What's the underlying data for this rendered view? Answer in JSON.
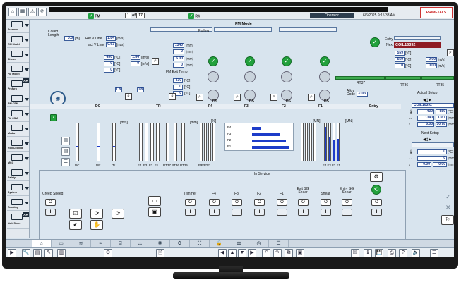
{
  "topbar": {
    "fm_label": "FM",
    "page_current": "1",
    "page_of": "of",
    "page_total": "17",
    "rm_label": "RM",
    "operator": "Operator",
    "datetime": "6/6/2025 9:15:33 AM",
    "logo": "PRIMETALS"
  },
  "sidebar": {
    "items": [
      {
        "label": "Furnace"
      },
      {
        "label": "RM Model"
      },
      {
        "label": "Shears"
      },
      {
        "label": "FM Model"
      },
      {
        "label": "Prkfurn"
      },
      {
        "label": "RM CSM"
      },
      {
        "label": "FM CSM"
      },
      {
        "label": "Media"
      },
      {
        "label": "Roll Cooling"
      },
      {
        "label": "MCC"
      },
      {
        "label": "Safety"
      },
      {
        "label": "System"
      },
      {
        "label": "Tracking"
      },
      {
        "label": "Volt. Sheet"
      }
    ],
    "ah": "AH"
  },
  "main": {
    "mode_title": "FM Mode",
    "rolling_label": "Rolling",
    "coiled_length": "Coiled Length",
    "coiled_length_val": "0.0",
    "coiled_length_unit": "[m]",
    "ref_v_line": "Ref V Line",
    "ref_v_line_val": "1.84",
    "act_v_line": "act V Line",
    "act_v_line_val": "0.63",
    "ms_unit": "[m/s]",
    "temp1": "430",
    "temp2": "0",
    "temp3": "0",
    "degc": "[°C]",
    "vel1": "1.84",
    "vel2": "0",
    "fm_exit_temp": "FM Exit Temp",
    "thick1": "1340",
    "thick2": "6.00",
    "thick3": "0",
    "mm": "[mm]",
    "exit_temp_val": "430",
    "exit_v2": "0",
    "exit_v3": "0",
    "small1": "1.8",
    "small2": "0.8",
    "entry_label": "Entry",
    "next_label": "Next",
    "coil_next": "COIL10392",
    "entry_t1": "559",
    "entry_t2": "559",
    "entry_t3": "0",
    "entry_v1": "0.00",
    "entry_v2": "0.00",
    "rt37": "RT37",
    "rt36": "RT36",
    "rt35": "RT35",
    "alloy_code_label": "Alloy Code",
    "alloy_code": "3103",
    "ds_label": "DS",
    "sections": [
      "DC",
      "TR",
      "F4",
      "F3",
      "F2",
      "F1",
      "Entry"
    ],
    "gauge_labels_left": [
      "DC",
      "DR",
      "Tr"
    ],
    "gauge_labels_mid": [
      "F4",
      "F3",
      "F2",
      "F1",
      "RT37",
      "RT36",
      "RT35"
    ],
    "gauge_labels_pct": [
      "F4",
      "F3",
      "F2",
      "F1"
    ],
    "gauge_labels_right": [
      "F4",
      "F3",
      "F2",
      "F1"
    ],
    "unit_ms": "[m/s]",
    "unit_mm": "[mm]",
    "unit_pct": "[%]",
    "unit_mn": "[MN]",
    "hbar_labels": [
      "F4",
      "F3",
      "F2",
      "F1"
    ],
    "actual_setup": "Actual Setup",
    "coil_actual": "COIL10392",
    "act_t": "430",
    "act_t2": "559",
    "act_w": "1340",
    "act_w2": "1361",
    "act_h": "6.00",
    "act_h2": "50.78",
    "next_setup": "Next Setup",
    "next_t": "0",
    "next_w": "0",
    "next_h": "0.00",
    "next_h2": "0.00"
  },
  "service": {
    "title": "In Service",
    "creep_speed": "Creep Speed",
    "columns": [
      "Trimmer",
      "F4",
      "F3",
      "F2",
      "F1",
      "Exit SG Shear",
      "Shear",
      "Entry SG Shear"
    ],
    "on_symbol": "O",
    "off_symbol": "I"
  },
  "bottom_tabs": [
    "home",
    "monitor",
    "rolls",
    "coils",
    "stands",
    "cooling",
    "fan",
    "hydraulics",
    "config",
    "lock",
    "scale",
    "clock",
    "list"
  ],
  "colors": {
    "green": "#22a13c",
    "blue_bar": "#1d3cc9",
    "dark_red": "#8e1b23",
    "panel_bg": "#d8e4ee"
  }
}
